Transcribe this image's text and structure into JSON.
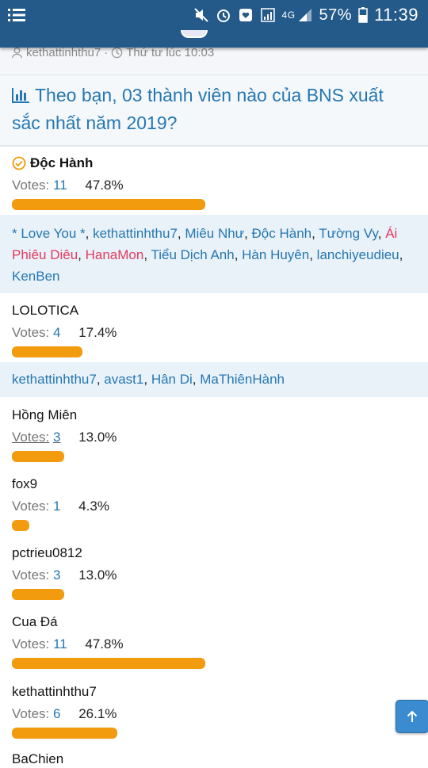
{
  "statusbar": {
    "network": "4G",
    "battery": "57%",
    "time": "11:39"
  },
  "meta": {
    "author": "kethattinhthu7",
    "separator": "·",
    "time": "Thứ tư lúc 10:03"
  },
  "poll": {
    "question": "Theo bạn, 03 thành viên nào của BNS xuất sắc nhất năm 2019?",
    "votes_label": "Votes:",
    "options": [
      {
        "name": "Độc Hành",
        "votes": "11",
        "percent": "47.8%",
        "fraction": 0.478,
        "selected": true
      },
      {
        "name": "LOLOTICA",
        "votes": "4",
        "percent": "17.4%",
        "fraction": 0.174
      },
      {
        "name": "Hồng Miên",
        "votes": "3",
        "percent": "13.0%",
        "fraction": 0.13
      },
      {
        "name": "fox9",
        "votes": "1",
        "percent": "4.3%",
        "fraction": 0.043
      },
      {
        "name": "pctrieu0812",
        "votes": "3",
        "percent": "13.0%",
        "fraction": 0.13
      },
      {
        "name": "Cua Đá",
        "votes": "11",
        "percent": "47.8%",
        "fraction": 0.478
      },
      {
        "name": "kethattinhthu7",
        "votes": "6",
        "percent": "26.1%",
        "fraction": 0.261
      },
      {
        "name": "BaChien",
        "votes": "",
        "percent": "",
        "fraction": 0
      }
    ],
    "voters_1": [
      "* Love You *",
      "kethattinhthu7",
      "Miêu Như",
      "Độc Hành",
      "Tường Vy",
      "Ái Phiêu Diêu",
      "HanaMon",
      "Tiểu Dịch Anh",
      "Hàn Huyên",
      "lanchiyeudieu",
      "KenBen"
    ],
    "voters_2": [
      "kethattinhthu7",
      "avast1",
      "Hân Di",
      "MaThiênHành"
    ]
  },
  "colors": {
    "header": "#235a8a",
    "link": "#2577b1",
    "bar": "#f29b0e",
    "voter_highlight": "#e23a5d"
  },
  "icons": [
    "menu-icon",
    "mute-icon",
    "alarm-icon",
    "heart-shield-icon",
    "signal-icon",
    "battery-icon",
    "user-icon",
    "clock-icon",
    "bar-chart-icon",
    "check-circle-icon",
    "arrow-up-icon"
  ]
}
